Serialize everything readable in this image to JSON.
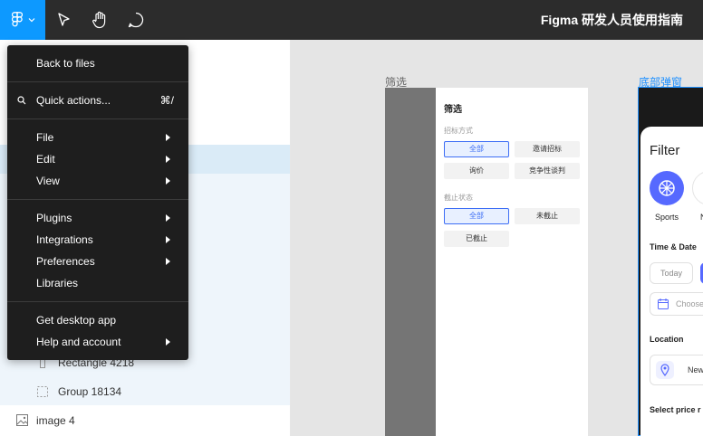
{
  "toolbar": {
    "doc_title": "Figma 研发人员使用指南",
    "icons": [
      "figma-logo-icon",
      "chevron-down-icon",
      "move-cursor-icon",
      "hand-icon",
      "comment-icon"
    ],
    "accent_color": "#0d99ff"
  },
  "menu": {
    "back_to_files": "Back to files",
    "quick_actions": "Quick actions...",
    "quick_actions_shortcut": "⌘/",
    "file": "File",
    "edit": "Edit",
    "view": "View",
    "plugins": "Plugins",
    "integrations": "Integrations",
    "preferences": "Preferences",
    "libraries": "Libraries",
    "get_desktop_app": "Get desktop app",
    "help_and_account": "Help and account"
  },
  "layers": {
    "items": [
      "Rectangle 4218",
      "Group 18134",
      "image 4"
    ]
  },
  "canvas": {
    "frame1": {
      "label": "筛选",
      "title": "筛选",
      "section1": "招标方式",
      "chips1": [
        "全部",
        "邀请招标",
        "询价",
        "竞争性谈判"
      ],
      "section2": "截止状态",
      "chips2": [
        "全部",
        "未截止",
        "已截止"
      ]
    },
    "frame2": {
      "label": "底部弹窗",
      "title": "Filter",
      "sports": "Sports",
      "letter_n": "N",
      "time_date": "Time & Date",
      "today": "Today",
      "choose": "Choose",
      "location": "Location",
      "new": "New",
      "select_price": "Select price r",
      "accent_color": "#5669ff"
    }
  }
}
